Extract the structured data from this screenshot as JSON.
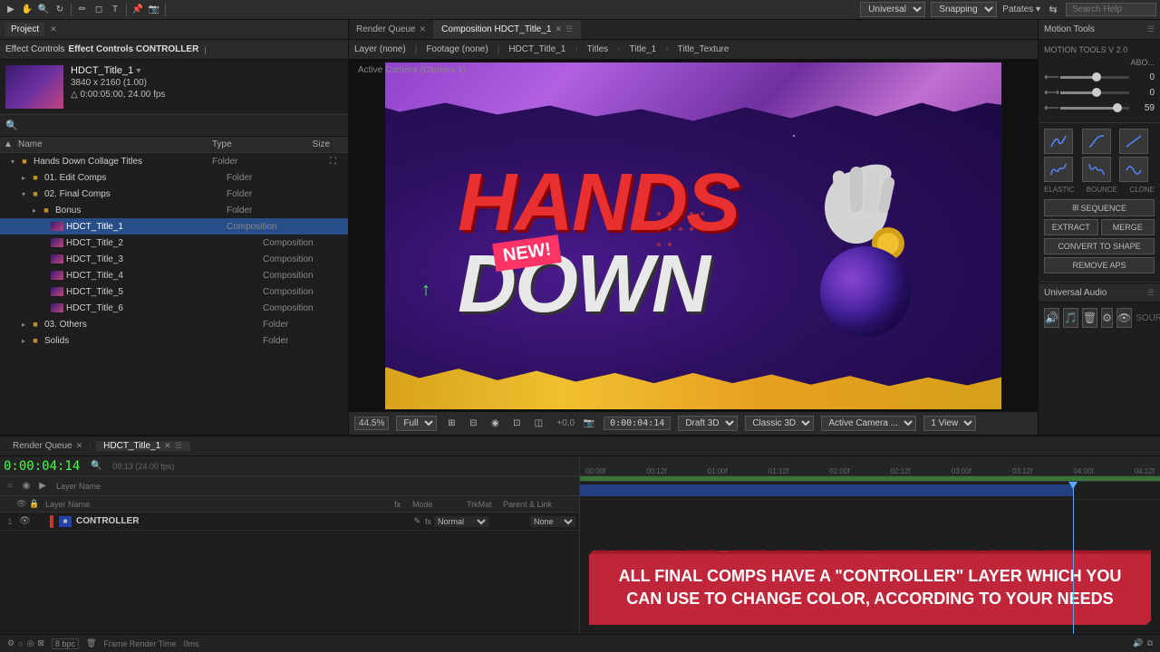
{
  "toolbar": {
    "dropdown_universal": "Universal",
    "dropdown_snapping": "Snapping",
    "search_placeholder": "Search Help",
    "search_label": "Patates ▾"
  },
  "top_tabs": {
    "project_tab": "Project",
    "effect_controls_tab": "Effect Controls CONTROLLER"
  },
  "effect_controls": {
    "comp_name": "HDCT_Title_1",
    "dimensions": "3840 x 2160 (1.00)",
    "duration": "△ 0:00:05:00, 24.00 fps"
  },
  "project": {
    "search_placeholder": "",
    "columns": {
      "name": "Name",
      "type": "Type",
      "size": "Size"
    },
    "tree": [
      {
        "id": "root",
        "label": "Hands Down Collage Titles",
        "type": "Folder",
        "level": 0,
        "open": true,
        "icon": "folder"
      },
      {
        "id": "01edit",
        "label": "01. Edit Comps",
        "type": "Folder",
        "level": 1,
        "open": false,
        "icon": "folder"
      },
      {
        "id": "02final",
        "label": "02. Final Comps",
        "type": "Folder",
        "level": 1,
        "open": true,
        "icon": "folder"
      },
      {
        "id": "bonus",
        "label": "Bonus",
        "type": "Folder",
        "level": 2,
        "open": false,
        "icon": "folder"
      },
      {
        "id": "hdct1",
        "label": "HDCT_Title_1",
        "type": "Composition",
        "level": 2,
        "selected": true,
        "icon": "comp"
      },
      {
        "id": "hdct2",
        "label": "HDCT_Title_2",
        "type": "Composition",
        "level": 2,
        "icon": "comp"
      },
      {
        "id": "hdct3",
        "label": "HDCT_Title_3",
        "type": "Composition",
        "level": 2,
        "icon": "comp"
      },
      {
        "id": "hdct4",
        "label": "HDCT_Title_4",
        "type": "Composition",
        "level": 2,
        "icon": "comp"
      },
      {
        "id": "hdct5",
        "label": "HDCT_Title_5",
        "type": "Composition",
        "level": 2,
        "icon": "comp"
      },
      {
        "id": "hdct6",
        "label": "HDCT_Title_6",
        "type": "Composition",
        "level": 2,
        "icon": "comp"
      },
      {
        "id": "03others",
        "label": "03. Others",
        "type": "Folder",
        "level": 1,
        "open": false,
        "icon": "folder"
      },
      {
        "id": "solids",
        "label": "Solids",
        "type": "Folder",
        "level": 1,
        "open": false,
        "icon": "folder"
      }
    ]
  },
  "composition": {
    "tab_label": "Composition HDCT_Title_1",
    "tabs": [
      "Composition HDCT_Title_1"
    ],
    "active_camera": "Active Camera (Camera 1)",
    "breadcrumbs": [
      "HDCT_Title_1",
      "Titles",
      "Title_1",
      "Title_Texture"
    ],
    "layer_tabs": [
      "Layer (none)",
      "Footage (none)"
    ],
    "zoom": "44.5%",
    "quality": "Full",
    "timecode": "0:00:04:14",
    "render_mode": "Draft 3D",
    "view_mode": "Classic 3D",
    "camera": "Active Camera ...",
    "views": "1 View",
    "time_value": "+0,0"
  },
  "motion_tools": {
    "title": "Motion Tools",
    "subtitle": "MOTION TOOLS v 2.0",
    "about_label": "ABO...",
    "slider1_value": "0",
    "slider2_value": "0",
    "slider3_value": "59",
    "elastic_label": "ELASTIC",
    "bounce_label": "BOUNCE",
    "clone_label": "CLONE",
    "sequence_label": "SEQUENCE",
    "extract_label": "EXTRACT",
    "merge_label": "MERGE",
    "convert_label": "CONVERT TO SHAPE",
    "remove_label": "REMOVE APS",
    "audio_title": "Universal Audio",
    "source_label": "SOURCE"
  },
  "timeline": {
    "render_queue_tab": "Render Queue",
    "comp_tab": "HDCT_Title_1",
    "time_display": "0:00:04:14",
    "time_detail": "09:13 (24.00 fps)",
    "columns": {
      "layer_name": "Layer Name",
      "mode": "Mode",
      "trim_mat": "TrkMat",
      "parent_link": "Parent & Link"
    },
    "layers": [
      {
        "number": "1",
        "name": "CONTROLLER",
        "color": "#cc3333",
        "mode": "Normal",
        "trkmat": "",
        "parent": "None",
        "has_label": true,
        "has_solo": false
      }
    ],
    "ruler_marks": [
      "00:00f",
      "00:12f",
      "01:00f",
      "01:12f",
      "02:00f",
      "02:12f",
      "03:00f",
      "03:12f",
      "04:00f",
      "04:12f"
    ],
    "playhead_pos": "85%",
    "annotation": "ALL FINAL COMPS HAVE A \"CONTROLLER\" LAYER WHICH YOU CAN USE TO CHANGE COLOR, ACCORDING TO YOUR NEEDS"
  },
  "status_bar": {
    "frame_render": "Frame Render Time",
    "time_value": "0ms"
  }
}
